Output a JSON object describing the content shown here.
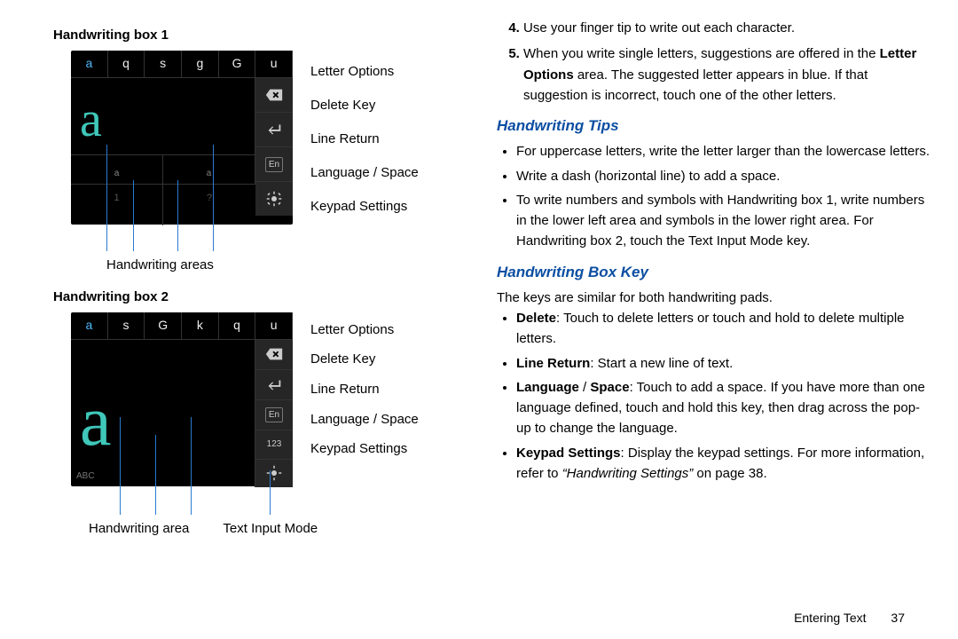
{
  "left": {
    "box1_label": "Handwriting box 1",
    "box2_label": "Handwriting box 2",
    "letters1": [
      "a",
      "q",
      "s",
      "g",
      "G",
      "u"
    ],
    "letters2": [
      "a",
      "s",
      "G",
      "k",
      "q",
      "u"
    ],
    "sub1_left": "1",
    "sub1_right": "?",
    "sub2_corner": "ABC",
    "mode_key": "123",
    "lang_badge": "En",
    "split_mid_a": "a",
    "split_mid_b": "a",
    "labels": {
      "letter_options": "Letter Options",
      "delete_key": "Delete Key",
      "line_return": "Line Return",
      "language_space": "Language / Space",
      "keypad_settings": "Keypad Settings"
    },
    "caption1": "Handwriting areas",
    "caption2a": "Handwriting area",
    "caption2b": "Text Input Mode"
  },
  "right": {
    "step4": "Use your finger tip to write out each character.",
    "step5_a": "When you write single letters, suggestions are offered in the ",
    "step5_bold": "Letter Options",
    "step5_b": " area. The suggested letter appears in blue. If that suggestion is incorrect, touch one of the other letters.",
    "tips_heading": "Handwriting Tips",
    "tips": [
      "For uppercase letters, write the letter larger than the lowercase letters.",
      "Write a dash (horizontal line) to add a space.",
      "To write numbers and symbols with Handwriting box 1, write numbers in the lower left area and symbols in the lower right area. For Handwriting box 2, touch the Text Input Mode key."
    ],
    "boxkey_heading": "Handwriting Box Key",
    "boxkey_intro": "The keys are similar for both handwriting pads.",
    "delete_label": "Delete",
    "delete_text": ": Touch to delete letters or touch and hold to delete multiple letters.",
    "line_label": "Line Return",
    "line_text": ": Start a new line of text.",
    "lang_label": "Language",
    "lang_slash": " / ",
    "space_label": "Space",
    "lang_text": ": Touch to add a space. If you have more than one language defined, touch and hold this key, then drag across the pop-up to change the language.",
    "kps_label": "Keypad Settings",
    "kps_text": ": Display the keypad settings. For more information, refer to ",
    "kps_ref": "“Handwriting Settings”",
    "kps_tail": "  on page 38."
  },
  "footer": {
    "section": "Entering Text",
    "page": "37"
  }
}
